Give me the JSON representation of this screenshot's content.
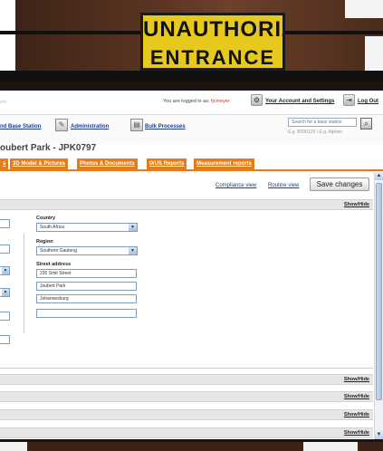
{
  "photo": {
    "sign_line1": "UNAUTHORIZED",
    "sign_line2": "ENTRANCE"
  },
  "header": {
    "logo_fragment": "ent",
    "logged_in_prefix": "You are logged in as:",
    "username": "fjcmeyer",
    "account_link": "Your Account and Settings",
    "logout_link": "Log Out"
  },
  "nav": {
    "items": [
      {
        "label": "nd Base Station"
      },
      {
        "label": "Administration"
      },
      {
        "label": "Bulk Processes"
      }
    ],
    "search": {
      "placeholder": "Search for a base station",
      "hint": "E.g. B000125 / E.g. Alphen"
    }
  },
  "page": {
    "title": "oubert Park - JPK0797"
  },
  "tabs": [
    {
      "label": "s"
    },
    {
      "label": "3D Model & Pictures"
    },
    {
      "label": "Photos & Documents"
    },
    {
      "label": "IXUS Reports"
    },
    {
      "label": "Measurement reports"
    }
  ],
  "views": {
    "compliance": "Compliance view",
    "routine": "Routine view",
    "save_label": "Save changes"
  },
  "section": {
    "show_hide": "Show/Hide"
  },
  "form": {
    "country_label": "Country",
    "country_value": "South Africa",
    "region_label": "Region",
    "region_value": "Southern Gauteng",
    "street_label": "Street address",
    "street_1": "230 Smit Street",
    "street_2": "Joubert Park",
    "street_3": "Johannesburg",
    "street_4": ""
  },
  "colors": {
    "tab_orange": "#e47b1a",
    "link_blue": "#1d3f8c",
    "sign_yellow": "#e7c91d"
  }
}
